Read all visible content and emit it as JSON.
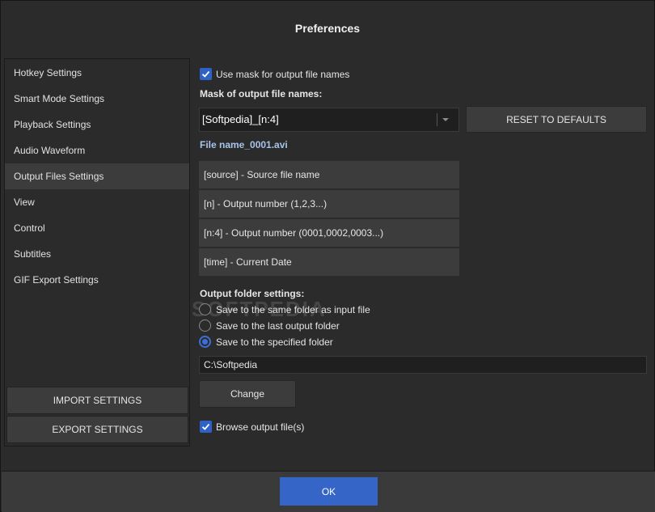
{
  "window": {
    "title": "Preferences"
  },
  "sidebar": {
    "items": [
      {
        "label": "Hotkey Settings",
        "active": false
      },
      {
        "label": "Smart Mode Settings",
        "active": false
      },
      {
        "label": "Playback Settings",
        "active": false
      },
      {
        "label": "Audio Waveform",
        "active": false
      },
      {
        "label": "Output Files Settings",
        "active": true
      },
      {
        "label": "View",
        "active": false
      },
      {
        "label": "Control",
        "active": false
      },
      {
        "label": "Subtitles",
        "active": false
      },
      {
        "label": "GIF Export Settings",
        "active": false
      }
    ],
    "import_label": "IMPORT SETTINGS",
    "export_label": "EXPORT SETTINGS"
  },
  "main": {
    "use_mask": {
      "label": "Use mask for output file names",
      "checked": true
    },
    "mask_heading": "Mask of output file names:",
    "mask_value": "[Softpedia]_[n:4]",
    "reset_label": "RESET TO DEFAULTS",
    "preview": "File name_0001.avi",
    "tokens": [
      "[source] - Source file name",
      "[n] - Output number (1,2,3...)",
      "[n:4] - Output number (0001,0002,0003...)",
      "[time] - Current Date"
    ],
    "folder_heading": "Output folder settings:",
    "folder_options": [
      {
        "label": "Save to the same folder as input file",
        "checked": false
      },
      {
        "label": "Save to the last output folder",
        "checked": false
      },
      {
        "label": "Save to the specified folder",
        "checked": true
      }
    ],
    "folder_path": "C:\\Softpedia",
    "change_label": "Change",
    "browse": {
      "label": "Browse output file(s)",
      "checked": true
    }
  },
  "footer": {
    "ok_label": "OK"
  },
  "watermark": "SOFTPEDIA",
  "colors": {
    "accent": "#3565c6",
    "background": "#2b2b2b",
    "panel": "#3c3c3c",
    "link": "#a9c4ec"
  }
}
